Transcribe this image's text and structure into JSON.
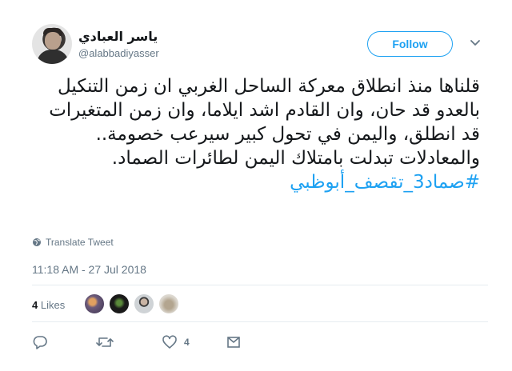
{
  "user": {
    "display_name": "ياسر العبادي",
    "handle": "@alabbadiyasser"
  },
  "follow_label": "Follow",
  "tweet": {
    "text": "قلناها منذ انطلاق معركة الساحل الغربي ان زمن التنكيل بالعدو قد حان، وان القادم اشد ايلاما، وان زمن المتغيرات قد انطلق، واليمن في تحول كبير سيرعب خصومة.. والمعادلات تبدلت بامتلاك اليمن لطائرات الصماد.",
    "hashtag": "#صماد3_تقصف_أبوظبي"
  },
  "translate_label": "Translate Tweet",
  "timestamp": "11:18 AM - 27 Jul 2018",
  "likes": {
    "count": "4",
    "label": "Likes"
  },
  "actions": {
    "reply_count": "",
    "retweet_count": "",
    "like_count": "4"
  },
  "colors": {
    "accent": "#1da1f2",
    "secondary_text": "#657786",
    "text": "#14171a",
    "divider": "#e6ecf0"
  },
  "icons": [
    "chevron-down-icon",
    "globe-icon",
    "reply-icon",
    "retweet-icon",
    "heart-icon",
    "direct-message-icon"
  ]
}
